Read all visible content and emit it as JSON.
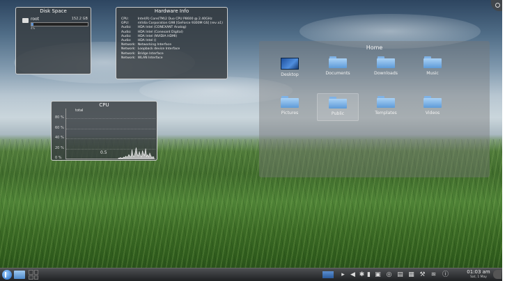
{
  "disk_widget": {
    "title": "Disk Space",
    "drive_name": "root",
    "drive_size": "152.2 GB",
    "used_fraction": 0.04,
    "used_text": "4%"
  },
  "hw_widget": {
    "title": "Hardware Info",
    "rows": [
      {
        "k": "CPU:",
        "v": "Intel(R) Core(TM)2 Duo CPU P8600 @ 2.40GHz"
      },
      {
        "k": "GPU:",
        "v": "nVidia Corporation G98 [GeForce 9300M GS] (rev a1)"
      },
      {
        "k": "Audio:",
        "v": "HDA Intel (CONEXANT Analog)"
      },
      {
        "k": "Audio:",
        "v": "HDA Intel (Conexant Digital)"
      },
      {
        "k": "Audio:",
        "v": "HDA Intel (NVIDIA HDMI)"
      },
      {
        "k": "Audio:",
        "v": "HDA Intel ()"
      },
      {
        "k": "Network:",
        "v": "Networking Interface"
      },
      {
        "k": "Network:",
        "v": "Loopback device Interface"
      },
      {
        "k": "Network:",
        "v": "Bridge Interface"
      },
      {
        "k": "Network:",
        "v": "WLAN Interface"
      }
    ]
  },
  "cpu_widget": {
    "title": "CPU",
    "series_label": "total",
    "current_value": "0.5",
    "y_ticks": [
      "80 %",
      "60 %",
      "40 %",
      "20 %",
      "0 %"
    ],
    "y_tick_values": [
      80,
      60,
      40,
      20,
      0
    ],
    "load_history": [
      1,
      1,
      2,
      1,
      1,
      3,
      2,
      5,
      3,
      4,
      8,
      5,
      3,
      18,
      6,
      4,
      12,
      22,
      9,
      5,
      14,
      7,
      3,
      16,
      10,
      6,
      20,
      4,
      8,
      3,
      11,
      6,
      2,
      4,
      3
    ]
  },
  "home_view": {
    "title": "Home",
    "items": [
      {
        "label": "Desktop",
        "type": "desktop",
        "selected": false
      },
      {
        "label": "Documents",
        "type": "folder",
        "selected": false
      },
      {
        "label": "Downloads",
        "type": "folder",
        "selected": false
      },
      {
        "label": "Music",
        "type": "folder",
        "selected": false
      },
      {
        "label": "Pictures",
        "type": "folder",
        "selected": false
      },
      {
        "label": "Public",
        "type": "folder",
        "selected": true
      },
      {
        "label": "Templates",
        "type": "folder",
        "selected": false
      },
      {
        "label": "Videos",
        "type": "folder",
        "selected": false
      }
    ]
  },
  "taskbar": {
    "clock_time": "01:03 am",
    "clock_date": "Sat, 1 May",
    "tray_icons": [
      "show-desktop-icon",
      "arrow-icon",
      "volume-icon",
      "bluetooth-icon",
      "battery-icon",
      "network-icon",
      "updates-icon",
      "printer-icon",
      "clipboard-icon",
      "device-notifier-icon",
      "wifi-icon",
      "info-icon"
    ]
  },
  "colors": {
    "widget_bg": "#373c40",
    "folder_blue": "#5e9bd8",
    "taskbar_bg": "#1f2123"
  }
}
